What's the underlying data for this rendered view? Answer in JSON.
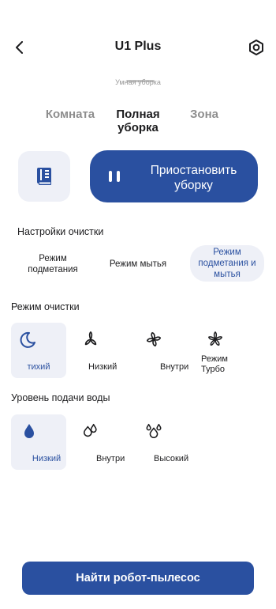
{
  "header": {
    "title": "U1 Plus",
    "back_icon": "chevron-left-icon",
    "settings_icon": "hexagon-nut-icon"
  },
  "status": {
    "text": "Умная уборка"
  },
  "tabs": [
    {
      "label": "Комната",
      "active": false
    },
    {
      "label": "Полная уборка",
      "active": true
    },
    {
      "label": "Зона",
      "active": false
    }
  ],
  "actions": {
    "book_icon": "book-icon",
    "pause_icon": "pause-icon",
    "pause_label": "Приостановить уборку"
  },
  "cleaning_settings": {
    "label": "Настройки очистки",
    "modes": [
      {
        "label": "Режим подметания",
        "selected": false
      },
      {
        "label": "Режим мытья",
        "selected": false
      },
      {
        "label": "Режим подметания и мытья",
        "selected": true
      }
    ]
  },
  "cleaning_mode": {
    "label": "Режим очистки",
    "options": [
      {
        "label": "тихий",
        "icon": "moon-icon",
        "selected": true
      },
      {
        "label": "Низкий",
        "icon": "fan-low-icon",
        "selected": false
      },
      {
        "label": "Внутри",
        "icon": "fan-medium-icon",
        "selected": false
      },
      {
        "label": "Режим Турбо",
        "icon": "fan-turbo-icon",
        "selected": false
      }
    ]
  },
  "water_level": {
    "label": "Уровень подачи воды",
    "options": [
      {
        "label": "Низкий",
        "icon": "water-drop-filled-icon",
        "selected": true
      },
      {
        "label": "Внутри",
        "icon": "water-drops-medium-icon",
        "selected": false
      },
      {
        "label": "Высокий",
        "icon": "water-drops-high-icon",
        "selected": false
      }
    ]
  },
  "footer": {
    "find_label": "Найти робот-пылесос"
  },
  "colors": {
    "accent": "#2a50a0",
    "selected_bg": "#eef0f7",
    "inactive_text": "#8e8e8e"
  }
}
